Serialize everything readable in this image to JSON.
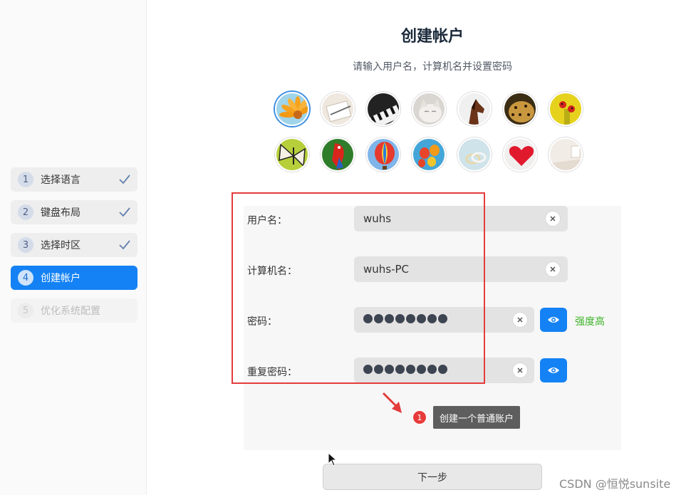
{
  "sidebar": {
    "steps": [
      {
        "num": "1",
        "label": "选择语言",
        "state": "done"
      },
      {
        "num": "2",
        "label": "键盘布局",
        "state": "done"
      },
      {
        "num": "3",
        "label": "选择时区",
        "state": "done"
      },
      {
        "num": "4",
        "label": "创建帐户",
        "state": "active"
      },
      {
        "num": "5",
        "label": "优化系统配置",
        "state": "disabled"
      }
    ]
  },
  "main": {
    "title": "创建帐户",
    "subtitle": "请输入用户名，计算机名并设置密码",
    "avatars": [
      "gerbera-flower",
      "notebook-pen",
      "piano-keys",
      "kitten",
      "horse",
      "leopard",
      "ladybugs",
      "butterfly",
      "parrot",
      "hot-air-balloon",
      "balloons",
      "rings",
      "red-heart",
      "room-interior"
    ],
    "selected_avatar": "gerbera-flower"
  },
  "form": {
    "username": {
      "label": "用户名：",
      "value": "wuhs"
    },
    "hostname": {
      "label": "计算机名：",
      "value": "wuhs-PC"
    },
    "password": {
      "label": "密码：",
      "masked_length": 8
    },
    "repeat_password": {
      "label": "重复密码：",
      "masked_length": 8
    },
    "strength": "强度高"
  },
  "annotation": {
    "badge": "1",
    "text": "创建一个普通账户"
  },
  "next_button": "下一步",
  "watermark": "CSDN @恒悦sunsite",
  "colors": {
    "accent": "#1482f4",
    "strength": "#3fb42a",
    "highlight": "#e43c3c"
  }
}
